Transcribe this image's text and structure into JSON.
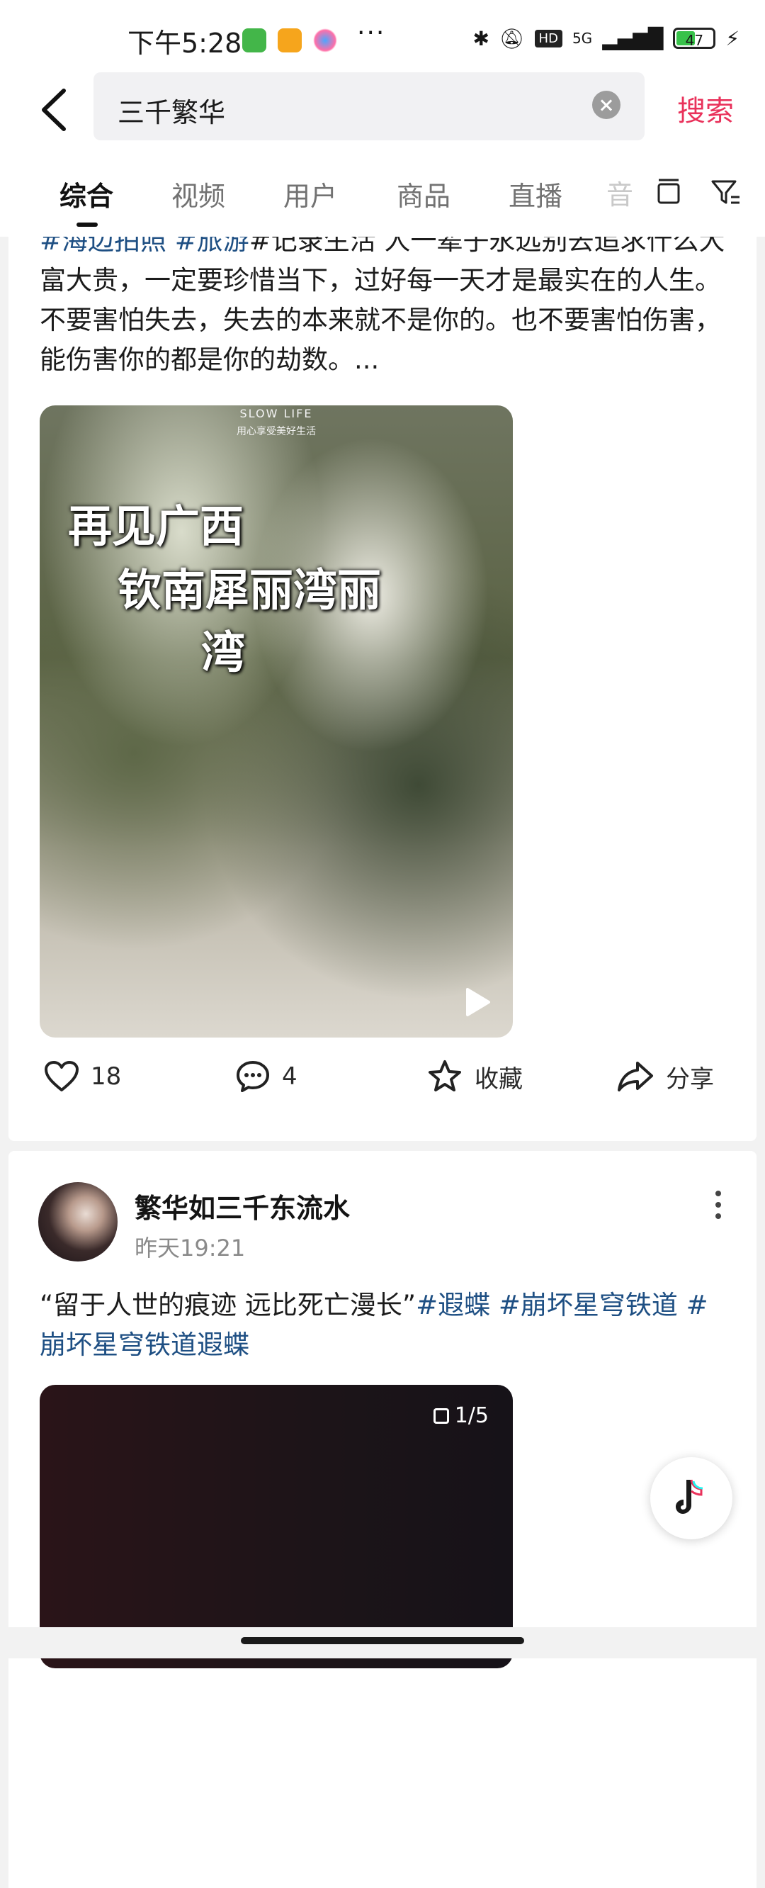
{
  "status_bar": {
    "time": "下午5:28",
    "battery": "47",
    "network": "5G"
  },
  "search": {
    "query": "三千繁华",
    "submit_label": "搜索"
  },
  "tabs": [
    {
      "label": "综合",
      "active": true
    },
    {
      "label": "视频"
    },
    {
      "label": "用户"
    },
    {
      "label": "商品"
    },
    {
      "label": "直播"
    },
    {
      "label": "音"
    }
  ],
  "post1": {
    "desc_tags": [
      "#海边拍照",
      "#旅游"
    ],
    "desc_text": "#记录生活 人一辈子永远别去追求什么大富大贵，一定要珍惜当下，过好每一天才是最实在的人生。不要害怕失去，失去的本来就不是你的。也不要害怕伤害，能伤害你的都是你的劫数。...",
    "watermark_top": "SLOW LIFE",
    "watermark_sub": "用心享受美好生活",
    "overlay_line1": "再见广西",
    "overlay_line2": "钦南犀丽湾丽",
    "overlay_line3": "湾",
    "likes": "18",
    "comments": "4",
    "favorite_label": "收藏",
    "share_label": "分享"
  },
  "post2": {
    "author": "繁华如三千东流水",
    "time": "昨天19:21",
    "desc_text": "“留于人世的痕迹 远比死亡漫长”",
    "tags": [
      "#遐蝶",
      "#崩坏星穹铁道",
      "#崩坏星穹铁道遐蝶"
    ],
    "image_counter": "1/5"
  },
  "colors": {
    "accent": "#e9325b",
    "hashtag": "#1e4f83"
  },
  "icons": [
    "back-icon",
    "clear-icon",
    "filter-icon",
    "heart-icon",
    "comment-icon",
    "star-icon",
    "share-icon",
    "more-icon",
    "play-icon",
    "douyin-icon"
  ]
}
